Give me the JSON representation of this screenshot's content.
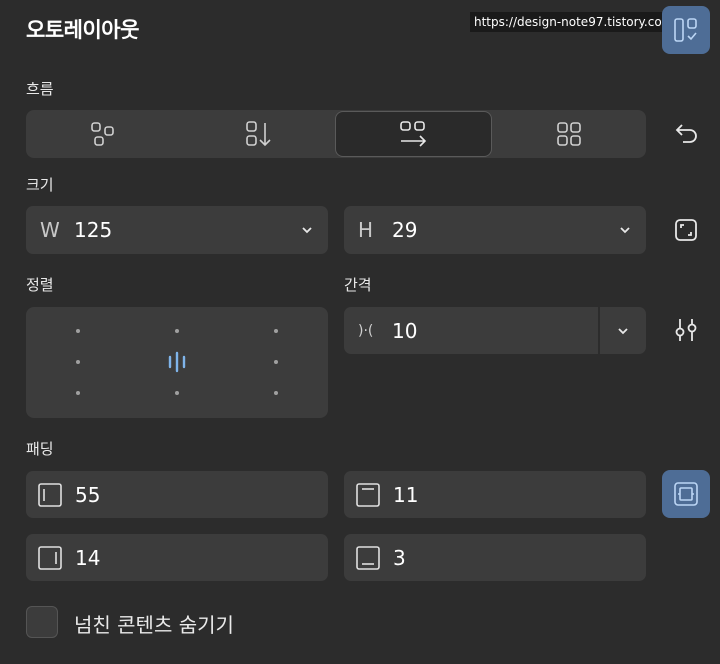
{
  "panel": {
    "title": "오토레이아웃",
    "watermark": "https://design-note97.tistory.com",
    "mode_icon": "layout-panel-check-icon"
  },
  "flow": {
    "label": "흐름",
    "options": [
      {
        "id": "freeform",
        "icon": "freeform-icon",
        "active": false
      },
      {
        "id": "vertical",
        "icon": "vertical-flow-icon",
        "active": false
      },
      {
        "id": "horizontal",
        "icon": "horizontal-flow-icon",
        "active": true
      },
      {
        "id": "grid",
        "icon": "grid-icon",
        "active": false
      }
    ],
    "wrap_icon": "wrap-return-icon"
  },
  "size": {
    "label": "크기",
    "width": {
      "prefix": "W",
      "value": "125"
    },
    "height": {
      "prefix": "H",
      "value": "29"
    },
    "resize_icon": "resize-to-fit-icon"
  },
  "alignment": {
    "label": "정렬",
    "selected": "center-center"
  },
  "gap": {
    "label": "간격",
    "prefix": ")·(",
    "value": "10",
    "settings_icon": "sliders-icon"
  },
  "padding": {
    "label": "패딩",
    "left": "55",
    "top": "11",
    "right": "14",
    "bottom": "3",
    "individual_icon": "individual-padding-icon"
  },
  "clip": {
    "label": "넘친 콘텐츠 숨기기",
    "checked": false
  },
  "colors": {
    "background": "#2c2c2c",
    "field": "#3c3c3c",
    "accent": "#4e6d96",
    "accent_icon": "#8fb8e8"
  }
}
